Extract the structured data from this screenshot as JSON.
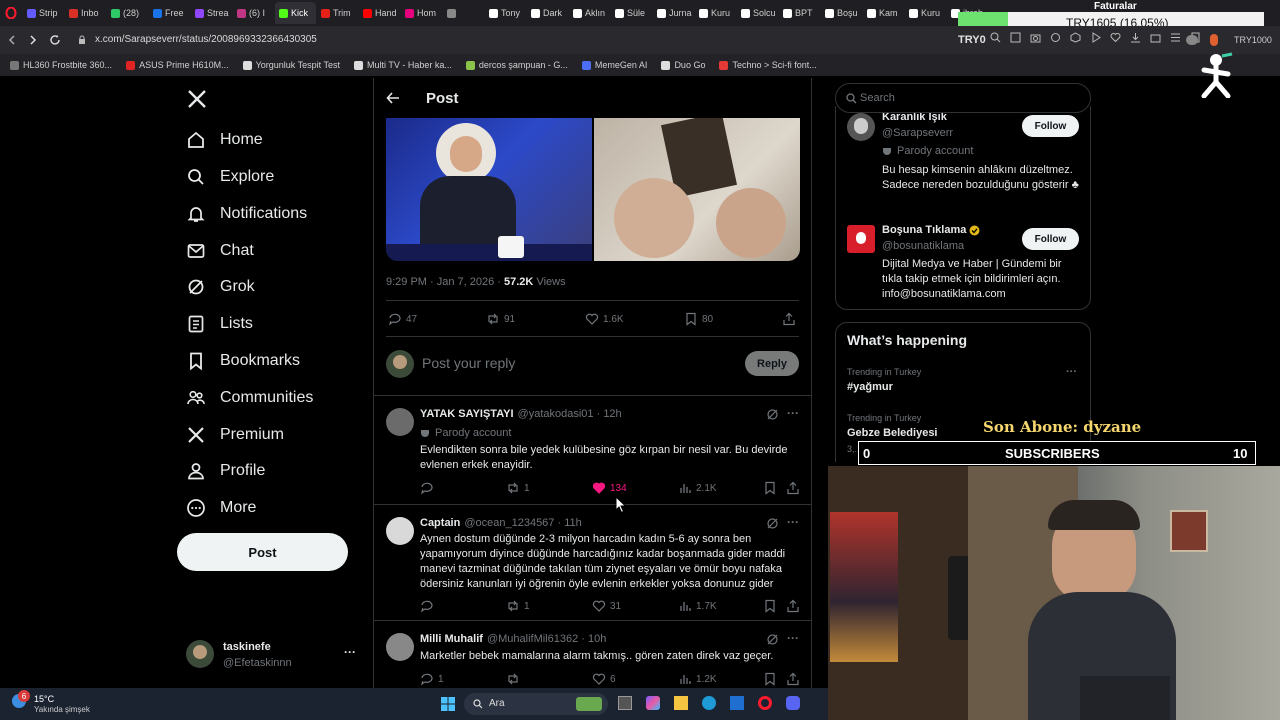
{
  "browser": {
    "tabs": [
      "Strip",
      "Inbo",
      "(28)",
      "Free",
      "Strea",
      "(6) I",
      "Kick",
      "Trim",
      "Hand",
      "Hom",
      "",
      "Tony",
      "Dark",
      "Aklın",
      "Süle",
      "Jurna",
      "Kuru",
      "Solcu",
      "BPT",
      "Boşu",
      "Kam",
      "Kuru",
      "ibrah"
    ],
    "url": "x.com/Sarapseverr/status/2008969332366430305",
    "bookmarks": [
      "HL360 Frostbite 360...",
      "ASUS Prime H610M...",
      "Yorgunluk Tespit Test",
      "Multi TV - Haber ka...",
      "dercos şampuan - G...",
      "MemeGen AI",
      "Duo Go",
      "Techno > Sci-fi font..."
    ]
  },
  "overlay": {
    "faturalar": "Faturalar",
    "try_ticker": "TRY1605 (16.05%)",
    "try_small": "TRY0",
    "try_right": "TRY1000",
    "son_abone": "Son Abone: dyzane",
    "subs_left": "0",
    "subs_label": "SUBSCRIBERS",
    "subs_right": "10"
  },
  "nav": {
    "items": [
      "Home",
      "Explore",
      "Notifications",
      "Chat",
      "Grok",
      "Lists",
      "Bookmarks",
      "Communities",
      "Premium",
      "Profile",
      "More"
    ],
    "post_label": "Post",
    "account_name": "taskinefe",
    "account_handle": "@Efetaskinnn",
    "more_dots": "···"
  },
  "header": {
    "title": "Post"
  },
  "tweet": {
    "meta_time": "9:29 PM · Jan 7, 2026 · ",
    "views_count": "57.2K",
    "views_label": "Views",
    "replies": "47",
    "reposts": "91",
    "likes": "1.6K",
    "bookmarks": "80"
  },
  "compose": {
    "placeholder": "Post your reply",
    "reply_label": "Reply"
  },
  "replies": [
    {
      "name": "YATAK SAYIŞTAYI",
      "handle": "@yatakodasi01 · 12h",
      "badge": "Parody account",
      "text": "Evlendikten sonra bile yedek kulübesine göz kırpan bir nesil var. Bu devirde evlenen erkek enayidir.",
      "replies": "",
      "reposts": "1",
      "likes": "134",
      "views": "2.1K"
    },
    {
      "name": "Captain",
      "handle": "@ocean_1234567 · 11h",
      "badge": "",
      "text": "Aynen dostum düğünde 2-3 milyon harcadın kadın 5-6 ay sonra ben yapamıyorum diyince düğünde harcadığınız kadar boşanmada gider maddi manevi tazminat düğünde takılan tüm ziynet eşyaları ve ömür boyu nafaka ödersiniz kanunları iyi öğrenin öyle evlenin erkekler yoksa donunuz gider",
      "replies": "",
      "reposts": "1",
      "likes": "31",
      "views": "1.7K"
    },
    {
      "name": "Milli Muhalif",
      "handle": "@MuhalifMil61362 · 10h",
      "badge": "",
      "text": "Marketler bebek mamalarına alarm takmış.. gören zaten direk vaz geçer.",
      "replies": "1",
      "reposts": "",
      "likes": "6",
      "views": "1.2K"
    }
  ],
  "right": {
    "search_placeholder": "Search",
    "accounts": [
      {
        "name": "Karanlık Işık",
        "handle": "@Sarapseverr",
        "badge": "Parody account",
        "bio": "Bu hesap kimsenin ahlâkını düzeltmez. Sadece nereden bozulduğunu gösterir ♣",
        "follow": "Follow"
      },
      {
        "name": "Boşuna Tıklama",
        "handle": "@bosunatiklama",
        "badge": "",
        "bio": "Dijital Medya ve Haber | Gündemi bir tıkla takip etmek için bildirimleri açın. info@bosunatiklama.com",
        "follow": "Follow"
      }
    ],
    "whats_happening": "What’s happening",
    "trends": [
      {
        "context": "Trending in Turkey",
        "title": "#yağmur",
        "posts": ""
      },
      {
        "context": "Trending in Turkey",
        "title": "Gebze Belediyesi",
        "posts": "3,... posts"
      }
    ]
  },
  "taskbar": {
    "temp": "15°C",
    "weather": "Yakında şimşek",
    "search": "Ara",
    "badge": "6"
  },
  "colors": {
    "like": "#f91880",
    "accent": "#1d9bf0",
    "gold": "#f5d76e"
  }
}
